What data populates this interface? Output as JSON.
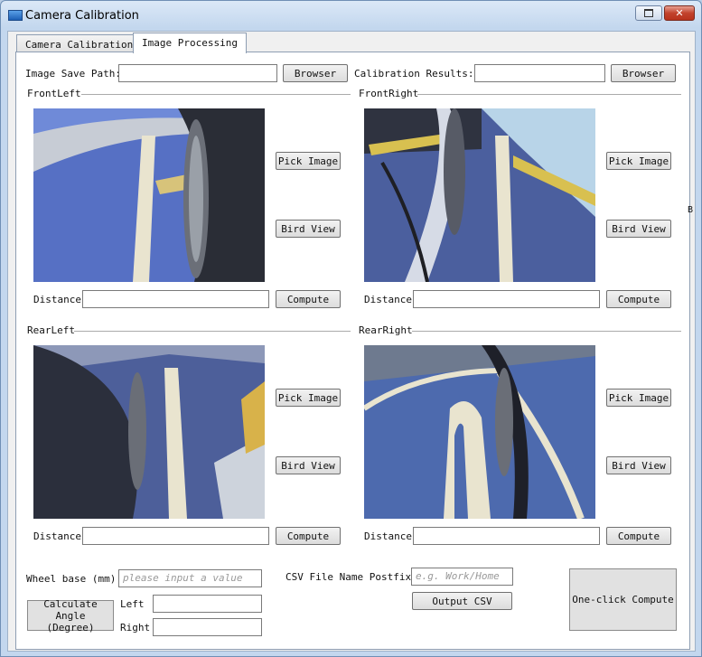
{
  "window": {
    "title": "Camera Calibration"
  },
  "icons": {
    "app": "app-window-icon",
    "restore": "restore-icon",
    "close": "close-icon"
  },
  "tabs": [
    {
      "label": "Camera Calibration",
      "active": false
    },
    {
      "label": "Image Processing",
      "active": true
    }
  ],
  "paths": {
    "image_save_label": "Image Save Path:",
    "image_save_value": "",
    "browse_label": "Browser",
    "calibration_label": "Calibration Results:",
    "calibration_value": "",
    "browse2_label": "Browser"
  },
  "cameras": [
    {
      "name": "FrontLeft",
      "pick": "Pick Image",
      "bird": "Bird View",
      "distance_label": "Distance",
      "distance_value": "",
      "compute": "Compute"
    },
    {
      "name": "FrontRight",
      "pick": "Pick Image",
      "bird": "Bird View",
      "distance_label": "Distance",
      "distance_value": "",
      "compute": "Compute"
    },
    {
      "name": "RearLeft",
      "pick": "Pick Image",
      "bird": "Bird View",
      "distance_label": "Distance",
      "distance_value": "",
      "compute": "Compute"
    },
    {
      "name": "RearRight",
      "pick": "Pick Image",
      "bird": "Bird View",
      "distance_label": "Distance",
      "distance_value": "",
      "compute": "Compute"
    }
  ],
  "bottom": {
    "wheelbase_label": "Wheel base (mm):",
    "wheelbase_placeholder": "please input a value",
    "calc_angle_label": "Calculate Angle\n(Degree)",
    "left_label": "Left",
    "right_label": "Right",
    "csv_label": "CSV File Name Postfix:",
    "csv_placeholder": "e.g. Work/Home",
    "output_csv": "Output CSV",
    "one_click": "One-click Compute",
    "edge_glyph": "B"
  },
  "colors": {
    "accent": "#5a7fd0",
    "floor": "#4f6cc0",
    "wall": "#2a2d36",
    "line": "#e9e4cf"
  }
}
